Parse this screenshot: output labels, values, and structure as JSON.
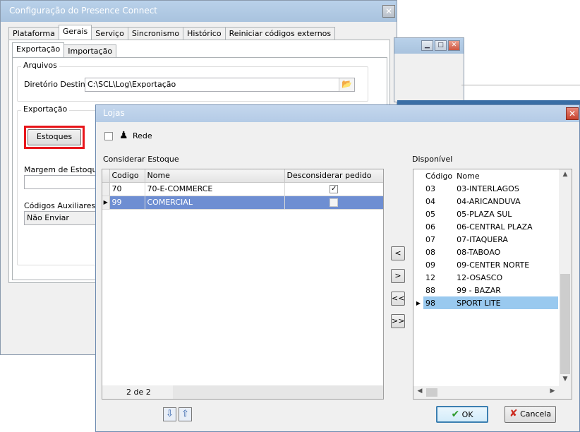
{
  "main_window": {
    "title": "Configuração do Presence Connect",
    "tabs": [
      "Plataforma",
      "Gerais",
      "Serviço",
      "Sincronismo",
      "Histórico",
      "Reiniciar códigos externos"
    ],
    "subtabs": [
      "Exportação",
      "Importação"
    ],
    "arquivos_label": "Arquivos",
    "diretorio_label": "Diretório Destino",
    "diretorio_value": "C:\\SCL\\Log\\Exportação",
    "exportacao_label": "Exportação",
    "estoques_button": "Estoques",
    "margem_label": "Margem de Estoque",
    "codigos_label": "Códigos Auxiliares",
    "codigos_value": "Não Enviar"
  },
  "dialog": {
    "title": "Lojas",
    "rede_label": "Rede",
    "considerar_label": "Considerar Estoque",
    "disponivel_label": "Disponível",
    "left_grid": {
      "columns": [
        "Codigo",
        "Nome",
        "Desconsiderar pedido"
      ],
      "rows": [
        {
          "codigo": "70",
          "nome": "70-E-COMMERCE",
          "checked": true
        },
        {
          "codigo": "99",
          "nome": "COMERCIAL",
          "checked": false
        }
      ],
      "footer": "2 de 2"
    },
    "right_grid": {
      "columns": [
        "Código",
        "Nome"
      ],
      "rows": [
        {
          "codigo": "03",
          "nome": "03-INTERLAGOS"
        },
        {
          "codigo": "04",
          "nome": "04-ARICANDUVA"
        },
        {
          "codigo": "05",
          "nome": "05-PLAZA SUL"
        },
        {
          "codigo": "06",
          "nome": "06-CENTRAL PLAZA"
        },
        {
          "codigo": "07",
          "nome": "07-ITAQUERA"
        },
        {
          "codigo": "08",
          "nome": "08-TABOAO"
        },
        {
          "codigo": "09",
          "nome": "09-CENTER NORTE"
        },
        {
          "codigo": "12",
          "nome": "12-OSASCO"
        },
        {
          "codigo": "88",
          "nome": "99 - BAZAR"
        },
        {
          "codigo": "98",
          "nome": "SPORT LITE"
        }
      ]
    },
    "transfer_buttons": [
      "<",
      ">",
      "<<",
      ">>"
    ],
    "ok_label": "OK",
    "cancel_label": "Cancela"
  },
  "colors": {
    "highlight": "#e8161b",
    "selection_left": "#6e8ed2",
    "selection_right": "#99c9ef"
  }
}
